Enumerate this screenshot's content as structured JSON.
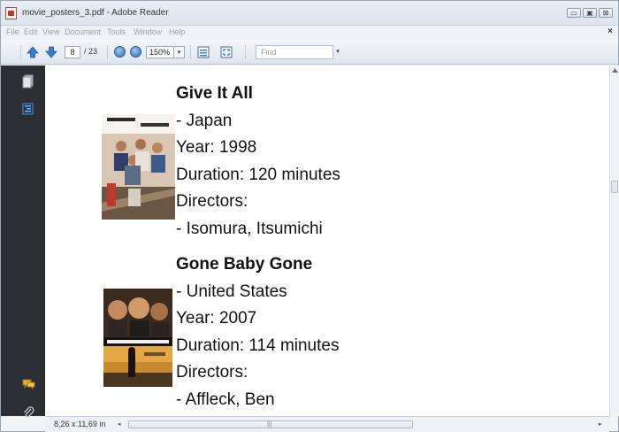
{
  "window": {
    "title": "movie_posters_3.pdf - Adobe Reader",
    "minimize_glyph": "▭",
    "maximize_glyph": "▣",
    "close_glyph": "⊠"
  },
  "menubar": {
    "items": [
      "File",
      "Edit",
      "View",
      "Document",
      "Tools",
      "Window",
      "Help"
    ],
    "close_glyph": "×"
  },
  "toolbar": {
    "current_page": "8",
    "total_pages": "/ 23",
    "zoom": "150%",
    "zoom_dropdown_glyph": "▾",
    "find_placeholder": "Find",
    "find_dropdown_glyph": "▾"
  },
  "movies": [
    {
      "title": "Give It All",
      "country": "- Japan",
      "year": "Year: 1998",
      "duration": "Duration: 120 minutes",
      "directors_label": "Directors:",
      "director": "- Isomura, Itsumichi"
    },
    {
      "title": "Gone Baby Gone",
      "country": "- United States",
      "year": "Year: 2007",
      "duration": "Duration: 114 minutes",
      "directors_label": "Directors:",
      "director": "- Affleck, Ben"
    }
  ],
  "statusbar": {
    "page_size": "8,26 x 11,69 in",
    "left_arrow": "◂",
    "right_arrow": "▸",
    "grip": "|||"
  },
  "colors": {
    "left_panel": "#2b2f35",
    "nav_arrow_blue": "#3a7cc7",
    "pdf_red": "#c8352a"
  }
}
